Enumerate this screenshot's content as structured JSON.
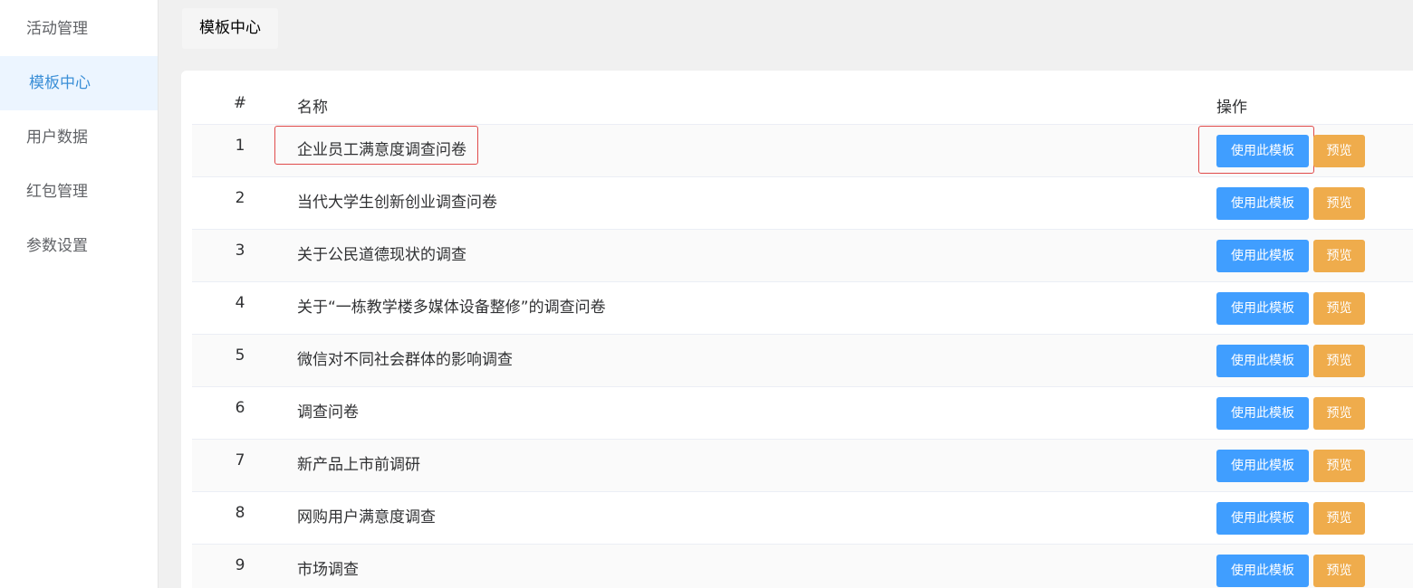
{
  "sidebar": {
    "items": [
      {
        "label": "活动管理",
        "active": false
      },
      {
        "label": "模板中心",
        "active": true
      },
      {
        "label": "用户数据",
        "active": false
      },
      {
        "label": "红包管理",
        "active": false
      },
      {
        "label": "参数设置",
        "active": false
      }
    ]
  },
  "breadcrumb": {
    "tab_label": "模板中心"
  },
  "table": {
    "headers": {
      "index": "#",
      "name": "名称",
      "ops": "操作"
    },
    "rows": [
      {
        "index": "1",
        "name": "企业员工满意度调查问卷"
      },
      {
        "index": "2",
        "name": "当代大学生创新创业调查问卷"
      },
      {
        "index": "3",
        "name": "关于公民道德现状的调查"
      },
      {
        "index": "4",
        "name": "关于“一栋教学楼多媒体设备整修”的调查问卷"
      },
      {
        "index": "5",
        "name": "微信对不同社会群体的影响调查"
      },
      {
        "index": "6",
        "name": "调查问卷"
      },
      {
        "index": "7",
        "name": "新产品上市前调研"
      },
      {
        "index": "8",
        "name": "网购用户满意度调查"
      },
      {
        "index": "9",
        "name": "市场调查"
      }
    ],
    "use_button_label": "使用此模板",
    "preview_button_label": "预览"
  },
  "colors": {
    "primary": "#409eff",
    "warning": "#efac4c",
    "active_menu_text": "#3b8fd7",
    "highlight_border": "#e04b4b"
  }
}
